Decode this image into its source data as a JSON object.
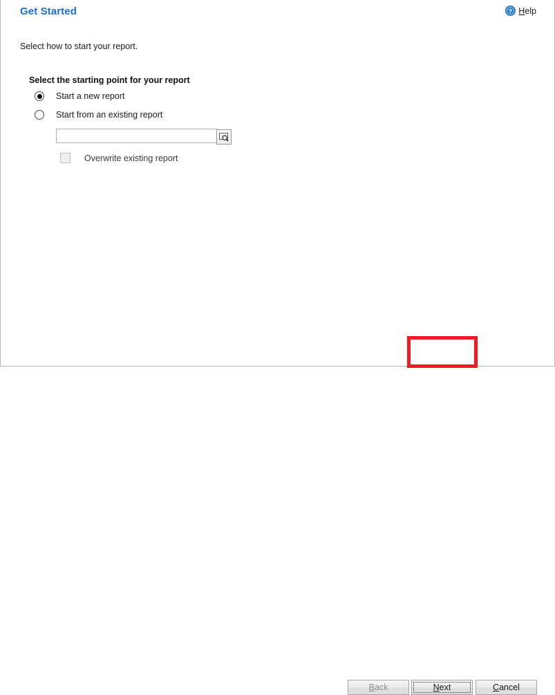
{
  "window": {
    "title": "Get Started"
  },
  "header": {
    "title": "Get Started",
    "help": {
      "icon": "help-circle-icon",
      "accel": "H",
      "rest": "elp"
    }
  },
  "main": {
    "intro_text": "Select how to start your report.",
    "group_label": "Select the starting point for your report",
    "options": [
      {
        "label": "Start a new report",
        "selected": true
      },
      {
        "label": "Start from an existing report",
        "selected": false
      }
    ],
    "existing_report_field": {
      "value": "",
      "placeholder": "",
      "browse_icon": "browse-search-icon"
    },
    "overwrite_checkbox": {
      "label": "Overwrite existing report",
      "checked": false,
      "disabled": true
    }
  },
  "footer": {
    "buttons": [
      {
        "name": "back",
        "accel": "B",
        "rest": "ack",
        "disabled": true,
        "focused": false
      },
      {
        "name": "next",
        "accel": "N",
        "rest": "ext",
        "disabled": false,
        "focused": true
      },
      {
        "name": "cancel",
        "accel": "C",
        "rest": "ancel",
        "disabled": false,
        "focused": false
      }
    ]
  },
  "annotation": {
    "highlight_color": "#ee1b22",
    "target": "next-button"
  },
  "colors": {
    "title_blue": "#1d6fd4",
    "help_blue": "#1a6fd0",
    "border_gray": "#b8b8b8",
    "highlight_red": "#ee1b22"
  }
}
